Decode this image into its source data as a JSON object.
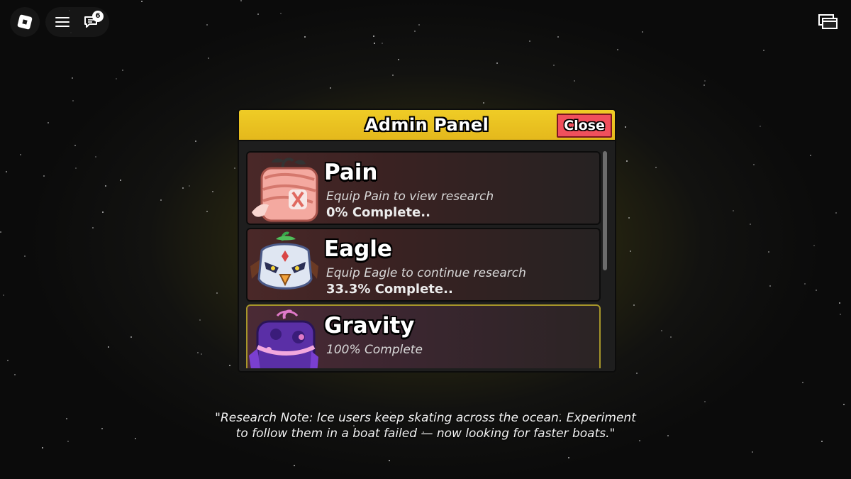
{
  "topbar": {
    "roblox_menu_icon": "roblox-logo-icon",
    "hamburger_icon": "hamburger-menu-icon",
    "chat_icon": "chat-icon",
    "chat_badge": "6",
    "screens_icon": "screens-icon"
  },
  "panel": {
    "title": "Admin Panel",
    "close_label": "Close",
    "colors": {
      "header": "#e9c021",
      "close": "#f0505c"
    }
  },
  "research": [
    {
      "name": "Pain",
      "subtitle": "Equip Pain to view research",
      "progress": "0% Complete..",
      "icon": "pain-fruit-icon"
    },
    {
      "name": "Eagle",
      "subtitle": "Equip Eagle to continue research",
      "progress": "33.3% Complete..",
      "icon": "eagle-fruit-icon"
    },
    {
      "name": "Gravity",
      "subtitle": "100% Complete",
      "progress": "",
      "icon": "gravity-fruit-icon"
    }
  ],
  "note": "\"Research Note: Ice users keep skating across the ocean. Experiment to follow them in a boat failed — now looking for faster boats.\""
}
